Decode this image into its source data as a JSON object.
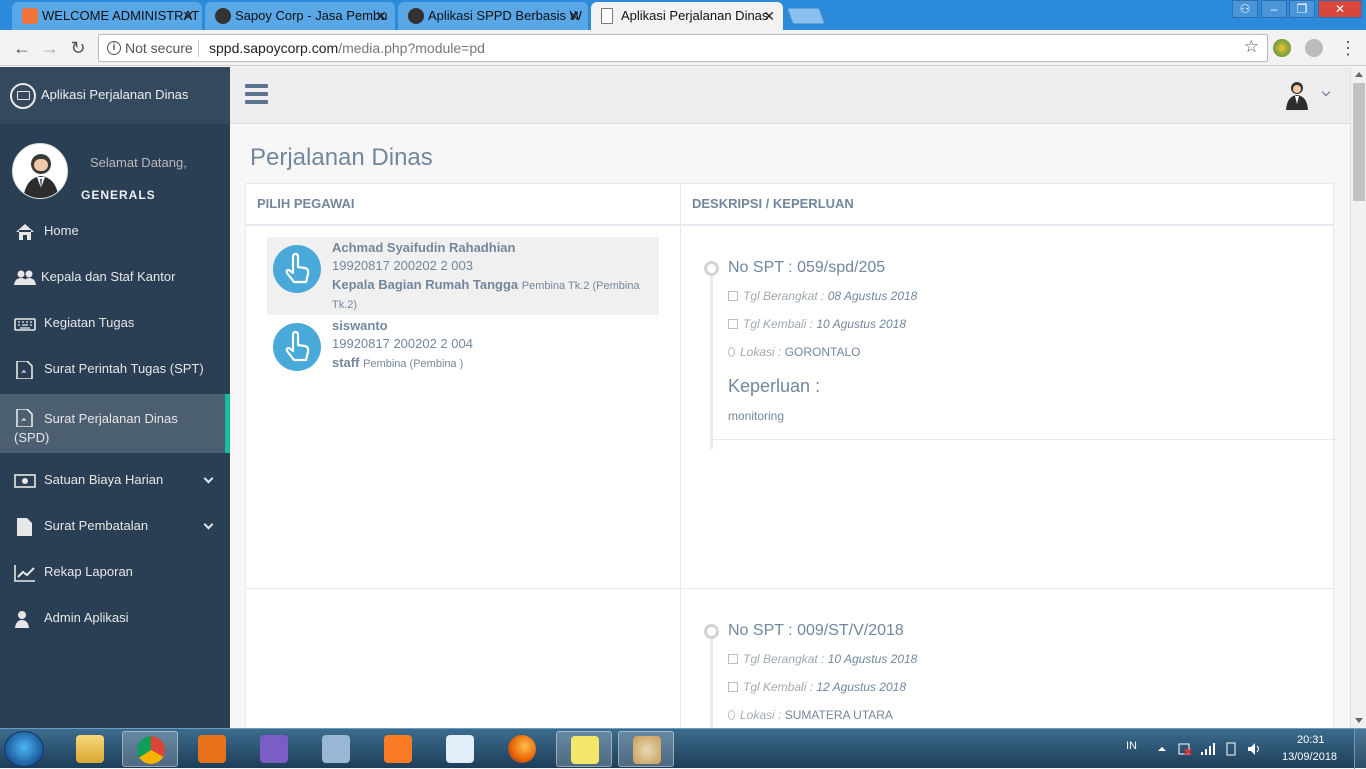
{
  "browser": {
    "tabs": [
      {
        "title": "WELCOME ADMINISTRAT",
        "active": false
      },
      {
        "title": "Sapoy Corp - Jasa Pembu",
        "active": false
      },
      {
        "title": "Aplikasi SPPD Berbasis W",
        "active": false
      },
      {
        "title": "Aplikasi Perjalanan Dinas",
        "active": true
      }
    ],
    "security_label": "Not secure",
    "url_host": "sppd.sapoycorp.com",
    "url_path": "/media.php?module=pd"
  },
  "sidebar": {
    "brand": "Aplikasi Perjalanan Dinas",
    "welcome": "Selamat Datang,",
    "username": "GENERALS",
    "menu": [
      {
        "label": "Home",
        "icon": "home-icon"
      },
      {
        "label": "Kepala dan Staf Kantor",
        "icon": "users-icon"
      },
      {
        "label": "Kegiatan Tugas",
        "icon": "keyboard-icon"
      },
      {
        "label": "Surat Perintah Tugas (SPT)",
        "icon": "pdf-file-icon"
      },
      {
        "label": "Surat Perjalanan Dinas (SPD)",
        "icon": "pdf-file-icon",
        "active": true
      },
      {
        "label": "Satuan Biaya Harian",
        "icon": "money-icon",
        "expandable": true
      },
      {
        "label": "Surat Pembatalan",
        "icon": "file-icon",
        "expandable": true
      },
      {
        "label": "Rekap Laporan",
        "icon": "line-chart-icon"
      },
      {
        "label": "Admin Aplikasi",
        "icon": "user-icon"
      }
    ]
  },
  "main": {
    "page_title": "Perjalanan Dinas",
    "col_pegawai": "PILIH PEGAWAI",
    "col_deskripsi": "DESKRIPSI / KEPERLUAN",
    "employees": [
      {
        "name": "Achmad Syaifudin Rahadhian",
        "nip": "19920817 200202 2 003",
        "jabatan": "Kepala Bagian Rumah Tangga",
        "golongan": "Pembina Tk.2 (Pembina Tk.2)",
        "selected": true
      },
      {
        "name": "siswanto",
        "nip": "19920817 200202 2 004",
        "jabatan": "staff",
        "golongan": "Pembina (Pembina )",
        "selected": false
      }
    ],
    "labels": {
      "tgl_berangkat": "Tgl Berangkat :",
      "tgl_kembali": "Tgl Kembali :",
      "lokasi": "Lokasi :",
      "keperluan": "Keperluan :"
    },
    "trips": [
      {
        "spt": "No SPT : 059/spd/205",
        "berangkat": "08 Agustus 2018",
        "kembali": "10 Agustus 2018",
        "lokasi": "GORONTALO",
        "keperluan": "monitoring"
      },
      {
        "spt": "No SPT : 009/ST/V/2018",
        "berangkat": "10 Agustus 2018",
        "kembali": "12 Agustus 2018",
        "lokasi": "SUMATERA UTARA"
      }
    ]
  },
  "taskbar": {
    "lang": "IN",
    "time": "20:31",
    "date": "13/09/2018"
  },
  "colors": {
    "sidebar_bg": "#2a3f54",
    "accent": "#1abb9c",
    "icon_blue": "#49a9d8"
  }
}
